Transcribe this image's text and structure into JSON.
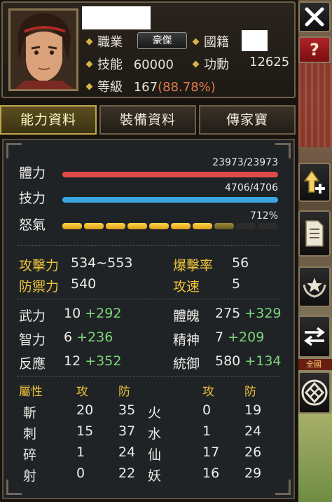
{
  "header": {
    "job_label": "職業",
    "job_value": "豪傑",
    "nationality_label": "國籍",
    "skill_label": "技能",
    "skill_value": "60000",
    "merit_label": "功勳",
    "merit_value": "12625",
    "level_label": "等級",
    "level_value": "167",
    "level_pct": "(88.78%)"
  },
  "tabs": [
    {
      "label": "能力資料",
      "active": true
    },
    {
      "label": "裝備資料",
      "active": false
    },
    {
      "label": "傳家寶",
      "active": false
    }
  ],
  "bars": {
    "hp": {
      "label": "體力",
      "text": "23973/23973",
      "fraction": 1.0,
      "color": "#e04a4a"
    },
    "mp": {
      "label": "技力",
      "text": "4706/4706",
      "fraction": 1.0,
      "color": "#3aa6e0"
    },
    "rage": {
      "label": "怒氣",
      "text": "712%",
      "segments_full": 7,
      "segments_partial": 1,
      "segments_total": 10
    }
  },
  "combat": {
    "attack_label": "攻擊力",
    "attack_value": "534~553",
    "crit_label": "爆擊率",
    "crit_value": "56",
    "defense_label": "防禦力",
    "defense_value": "540",
    "speed_label": "攻速",
    "speed_value": "5"
  },
  "attributes": [
    {
      "label": "武力",
      "base": "10",
      "bonus": "+292"
    },
    {
      "label": "體魄",
      "base": "275",
      "bonus": "+329"
    },
    {
      "label": "智力",
      "base": "6",
      "bonus": "+236"
    },
    {
      "label": "精神",
      "base": "7",
      "bonus": "+209"
    },
    {
      "label": "反應",
      "base": "12",
      "bonus": "+352"
    },
    {
      "label": "統御",
      "base": "580",
      "bonus": "+134"
    }
  ],
  "elements": {
    "header_attr": "屬性",
    "header_atk": "攻",
    "header_def": "防",
    "rows_left": [
      {
        "name": "斬",
        "atk": "20",
        "def": "35"
      },
      {
        "name": "刺",
        "atk": "15",
        "def": "37"
      },
      {
        "name": "碎",
        "atk": "1",
        "def": "24"
      },
      {
        "name": "射",
        "atk": "0",
        "def": "22"
      }
    ],
    "rows_right": [
      {
        "name": "火",
        "atk": "0",
        "def": "19"
      },
      {
        "name": "水",
        "atk": "1",
        "def": "24"
      },
      {
        "name": "仙",
        "atk": "17",
        "def": "26"
      },
      {
        "name": "妖",
        "atk": "16",
        "def": "29"
      }
    ]
  },
  "sidebar": {
    "close_icon": "close-icon",
    "help_icon": "question-icon",
    "levelup_icon": "arrow-up-plus-icon",
    "document_icon": "document-icon",
    "rank_icon": "star-laurel-icon",
    "swap_icon": "swap-arrows-icon",
    "emblem_icon": "emblem-icon",
    "help_glyph": "?"
  },
  "scene": {
    "banner_text": "全國"
  }
}
